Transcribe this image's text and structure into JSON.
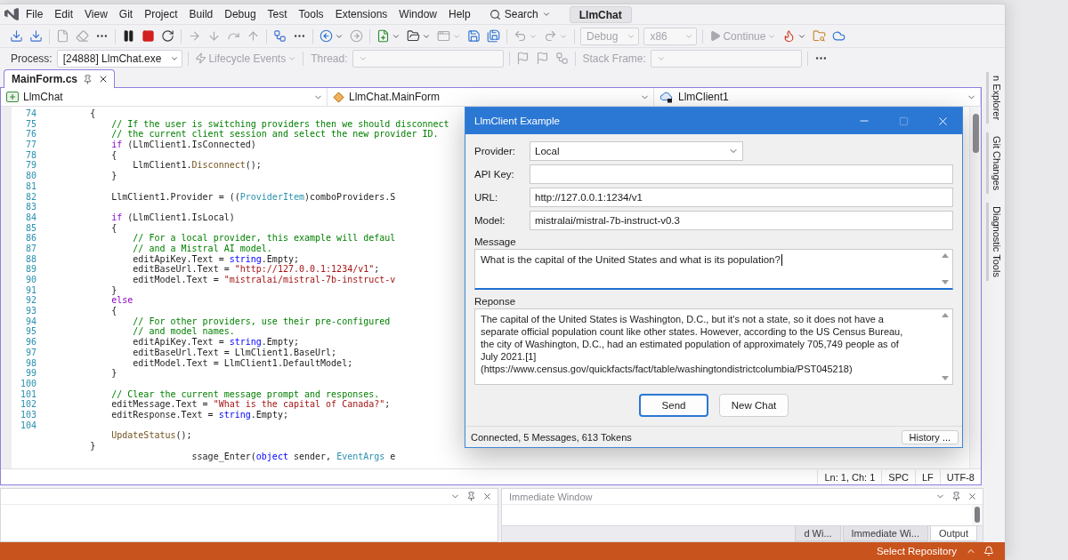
{
  "ide": {
    "menu": [
      "File",
      "Edit",
      "View",
      "Git",
      "Project",
      "Build",
      "Debug",
      "Test",
      "Tools",
      "Extensions",
      "Window",
      "Help"
    ],
    "search": "Search",
    "solution_name": "LlmChat",
    "toolbar": [
      {
        "items": [
          {
            "kind": "tray-arrow",
            "disabled": false,
            "dropdown": false
          },
          {
            "kind": "tray-arrow",
            "disabled": false,
            "dropdown": false
          }
        ]
      },
      {
        "items": [
          {
            "kind": "file",
            "disabled": true,
            "dropdown": false
          },
          {
            "kind": "clear",
            "disabled": true,
            "dropdown": false
          },
          {
            "kind": "more",
            "disabled": false,
            "dropdown": false
          }
        ]
      },
      {
        "items": [
          {
            "kind": "pause",
            "disabled": false,
            "dropdown": false
          },
          {
            "kind": "stop",
            "disabled": false,
            "dropdown": false
          },
          {
            "kind": "restart",
            "disabled": false,
            "dropdown": false
          }
        ]
      },
      {
        "items": [
          {
            "kind": "step-next",
            "disabled": true,
            "dropdown": false
          },
          {
            "kind": "step-into",
            "disabled": true,
            "dropdown": false
          },
          {
            "kind": "step-over",
            "disabled": true,
            "dropdown": false
          },
          {
            "kind": "step-out",
            "disabled": true,
            "dropdown": false
          }
        ]
      },
      {
        "items": [
          {
            "kind": "threads",
            "disabled": false,
            "dropdown": false
          },
          {
            "kind": "more",
            "disabled": false,
            "dropdown": false
          }
        ]
      },
      {
        "items": [
          {
            "kind": "back",
            "disabled": false,
            "dropdown": true
          },
          {
            "kind": "forward",
            "disabled": true,
            "dropdown": false
          }
        ]
      },
      {
        "items": [
          {
            "kind": "new-project",
            "disabled": false,
            "dropdown": true
          },
          {
            "kind": "open-file",
            "disabled": false,
            "dropdown": true
          },
          {
            "kind": "window",
            "disabled": true,
            "dropdown": true
          },
          {
            "kind": "save",
            "disabled": false,
            "dropdown": false
          },
          {
            "kind": "save-all",
            "disabled": false,
            "dropdown": false
          }
        ]
      },
      {
        "items": [
          {
            "kind": "undo",
            "disabled": true,
            "dropdown": true
          },
          {
            "kind": "redo",
            "disabled": true,
            "dropdown": true
          }
        ]
      },
      {
        "items": [
          {
            "kind": "combo",
            "text": "Debug",
            "disabled": true,
            "dropdown": true
          },
          {
            "kind": "combo",
            "text": "x86",
            "disabled": true,
            "dropdown": true
          }
        ]
      },
      {
        "items": [
          {
            "kind": "run",
            "text": "Continue",
            "disabled": true,
            "dropdown": true
          },
          {
            "kind": "flame",
            "disabled": false,
            "dropdown": true
          },
          {
            "kind": "folder-search",
            "disabled": false,
            "dropdown": false
          },
          {
            "kind": "cloud",
            "disabled": false,
            "dropdown": false
          }
        ]
      }
    ],
    "debug_location": [
      {
        "items": [
          {
            "kind": "label",
            "text": "Process:",
            "disabled": false,
            "dropdown": false
          },
          {
            "kind": "combo",
            "text": "[24888] LlmChat.exe",
            "disabled": false,
            "dropdown": true
          }
        ]
      },
      {
        "items": [
          {
            "kind": "events",
            "text": "Lifecycle Events",
            "disabled": true,
            "dropdown": true
          }
        ]
      },
      {
        "items": [
          {
            "kind": "label",
            "text": "Thread:",
            "disabled": true,
            "dropdown": false
          },
          {
            "kind": "combo",
            "disabled": true,
            "dropdown": true
          }
        ]
      },
      {
        "items": [
          {
            "kind": "flag",
            "disabled": true,
            "dropdown": false
          },
          {
            "kind": "flag",
            "disabled": true,
            "dropdown": false
          },
          {
            "kind": "threads",
            "disabled": true,
            "dropdown": false
          }
        ]
      },
      {
        "items": [
          {
            "kind": "label",
            "text": "Stack Frame:",
            "disabled": true,
            "dropdown": false
          },
          {
            "kind": "combo",
            "disabled": true,
            "dropdown": true
          }
        ]
      },
      {
        "items": [
          {
            "kind": "more",
            "disabled": false,
            "dropdown": false
          }
        ]
      }
    ],
    "document_tabs": [
      {
        "label": "MainForm.cs",
        "selected": true
      }
    ],
    "nav_bar": [
      {
        "kind": "project",
        "text": "LlmChat"
      },
      {
        "kind": "class",
        "text": "LlmChat.MainForm"
      },
      {
        "kind": "member",
        "text": "LlmClient1"
      }
    ],
    "code": [
      {
        "number": "74",
        "tokens": [
          {
            "kind": "plain",
            "text": "        {"
          }
        ]
      },
      {
        "number": "75",
        "tokens": [
          {
            "kind": "comment",
            "text": "            // If the user is switching providers then we should disconnect"
          }
        ]
      },
      {
        "number": "76",
        "tokens": [
          {
            "kind": "comment",
            "text": "            // the current client session and select the new provider ID."
          }
        ]
      },
      {
        "number": "77",
        "tokens": [
          {
            "kind": "control",
            "text": "            if"
          },
          {
            "kind": "plain",
            "text": " (LlmClient1.IsConnected)"
          }
        ]
      },
      {
        "number": "78",
        "tokens": [
          {
            "kind": "plain",
            "text": "            {"
          }
        ]
      },
      {
        "number": "79",
        "tokens": [
          {
            "kind": "plain",
            "text": "                LlmClient1."
          },
          {
            "kind": "method",
            "text": "Disconnect"
          },
          {
            "kind": "plain",
            "text": "();"
          }
        ]
      },
      {
        "number": "80",
        "tokens": [
          {
            "kind": "plain",
            "text": "            }"
          }
        ]
      },
      {
        "number": "81"
      },
      {
        "number": "82",
        "tokens": [
          {
            "kind": "plain",
            "text": "            LlmClient1.Provider = (("
          },
          {
            "kind": "type",
            "text": "ProviderItem"
          },
          {
            "kind": "plain",
            "text": ")comboProviders.S"
          }
        ]
      },
      {
        "number": "83"
      },
      {
        "number": "84",
        "tokens": [
          {
            "kind": "control",
            "text": "            if"
          },
          {
            "kind": "plain",
            "text": " (LlmClient1.IsLocal)"
          }
        ]
      },
      {
        "number": "85",
        "tokens": [
          {
            "kind": "plain",
            "text": "            {"
          }
        ]
      },
      {
        "number": "86",
        "tokens": [
          {
            "kind": "comment",
            "text": "                // For a local provider, this example will defaul"
          }
        ]
      },
      {
        "number": "87",
        "tokens": [
          {
            "kind": "comment",
            "text": "                // and a Mistral AI model."
          }
        ]
      },
      {
        "number": "88",
        "tokens": [
          {
            "kind": "plain",
            "text": "                editApiKey.Text = "
          },
          {
            "kind": "keyword",
            "text": "string"
          },
          {
            "kind": "plain",
            "text": ".Empty;"
          }
        ]
      },
      {
        "number": "89",
        "tokens": [
          {
            "kind": "plain",
            "text": "                editBaseUrl.Text = "
          },
          {
            "kind": "string",
            "text": "\"http://127.0.0.1:1234/v1\""
          },
          {
            "kind": "plain",
            "text": ";"
          }
        ]
      },
      {
        "number": "90",
        "tokens": [
          {
            "kind": "plain",
            "text": "                editModel.Text = "
          },
          {
            "kind": "string",
            "text": "\"mistralai/mistral-7b-instruct-v"
          }
        ]
      },
      {
        "number": "91",
        "tokens": [
          {
            "kind": "plain",
            "text": "            }"
          }
        ]
      },
      {
        "number": "92",
        "tokens": [
          {
            "kind": "control",
            "text": "            else"
          }
        ]
      },
      {
        "number": "93",
        "tokens": [
          {
            "kind": "plain",
            "text": "            {"
          }
        ]
      },
      {
        "number": "94",
        "tokens": [
          {
            "kind": "comment",
            "text": "                // For other providers, use their pre-configured"
          }
        ]
      },
      {
        "number": "95",
        "tokens": [
          {
            "kind": "comment",
            "text": "                // and model names."
          }
        ]
      },
      {
        "number": "96",
        "tokens": [
          {
            "kind": "plain",
            "text": "                editApiKey.Text = "
          },
          {
            "kind": "keyword",
            "text": "string"
          },
          {
            "kind": "plain",
            "text": ".Empty;"
          }
        ]
      },
      {
        "number": "97",
        "tokens": [
          {
            "kind": "plain",
            "text": "                editBaseUrl.Text = LlmClient1.BaseUrl;"
          }
        ]
      },
      {
        "number": "98",
        "tokens": [
          {
            "kind": "plain",
            "text": "                editModel.Text = LlmClient1.DefaultModel;"
          }
        ]
      },
      {
        "number": "99",
        "tokens": [
          {
            "kind": "plain",
            "text": "            }"
          }
        ]
      },
      {
        "number": "100"
      },
      {
        "number": "101",
        "tokens": [
          {
            "kind": "comment",
            "text": "            // Clear the current message prompt and responses."
          }
        ]
      },
      {
        "number": "102",
        "tokens": [
          {
            "kind": "plain",
            "text": "            editMessage.Text = "
          },
          {
            "kind": "string",
            "text": "\"What is the capital of Canada?\""
          },
          {
            "kind": "plain",
            "text": ";"
          }
        ]
      },
      {
        "number": "103",
        "tokens": [
          {
            "kind": "plain",
            "text": "            editResponse.Text = "
          },
          {
            "kind": "keyword",
            "text": "string"
          },
          {
            "kind": "plain",
            "text": ".Empty;"
          }
        ]
      },
      {
        "number": "104"
      },
      {
        "tokens": [
          {
            "kind": "method",
            "text": "            UpdateStatus"
          },
          {
            "kind": "plain",
            "text": "();"
          }
        ]
      },
      {
        "tokens": [
          {
            "kind": "plain",
            "text": "        }"
          }
        ]
      },
      {
        "tokens": [
          {
            "kind": "plain",
            "text": "                           ssage_Enter("
          },
          {
            "kind": "keyword",
            "text": "object"
          },
          {
            "kind": "plain",
            "text": " sender, "
          },
          {
            "kind": "type",
            "text": "EventArgs"
          },
          {
            "kind": "plain",
            "text": " e"
          }
        ]
      }
    ],
    "side_tabs": [
      "n Explorer",
      "Git Changes",
      "Diagnostic Tools"
    ],
    "editor_status": [
      "Ln: 1, Ch: 1",
      "SPC",
      "LF",
      "UTF-8"
    ],
    "bottom_pane": {
      "title": "Immediate Window",
      "tabs": [
        {
          "label": "d Wi...",
          "selected": false
        },
        {
          "label": "Immediate Wi...",
          "selected": false
        },
        {
          "label": "Output",
          "selected": true
        }
      ]
    },
    "status_bar": {
      "text": "Select Repository"
    }
  },
  "dialog": {
    "title": "LlmClient Example",
    "window_buttons": [
      {
        "kind": "minimize",
        "disabled": false
      },
      {
        "kind": "maximize",
        "disabled": true
      },
      {
        "kind": "close",
        "disabled": false
      }
    ],
    "fields": [
      {
        "label": "Provider:",
        "kind": "combo",
        "value": "Local"
      },
      {
        "label": "API Key:",
        "kind": "text"
      },
      {
        "label": "URL:",
        "kind": "text",
        "value": "http://127.0.0.1:1234/v1"
      },
      {
        "label": "Model:",
        "kind": "text",
        "value": "mistralai/mistral-7b-instruct-v0.3"
      }
    ],
    "message": {
      "label": "Message",
      "value": "What is the capital of the United States and what is its population?",
      "focused": true
    },
    "response": {
      "label": "Reponse",
      "lines": [
        "The capital of the United States is Washington, D.C., but it's not a state, so it does not have a",
        "separate official population count like other states. However, according to the US Census Bureau,",
        "the city of Washington, D.C., had an estimated population of approximately 705,749 people as of",
        "July 2021.[1]",
        "(https://www.census.gov/quickfacts/fact/table/washingtondistrictcolumbia/PST045218)"
      ]
    },
    "buttons": [
      {
        "label": "Send",
        "default": true
      },
      {
        "label": "New Chat",
        "default": false
      }
    ],
    "status": {
      "text": "Connected, 5 Messages, 613 Tokens",
      "button": "History ..."
    }
  }
}
